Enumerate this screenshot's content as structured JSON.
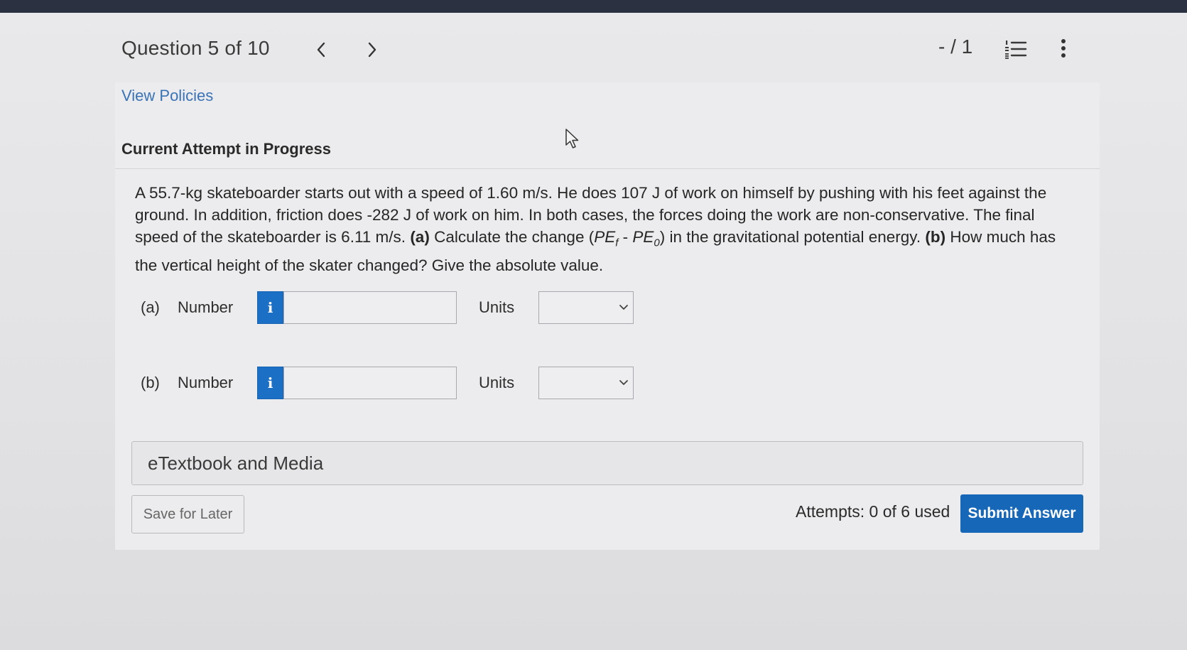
{
  "header": {
    "question_label": "Question 5 of 10",
    "score": "- / 1"
  },
  "policies_link": "View Policies",
  "attempt_heading": "Current Attempt in Progress",
  "question": {
    "intro": "A 55.7-kg skateboarder starts out with a speed of 1.60 m/s. He does 107 J of work on himself by pushing with his feet against the ground. In addition, friction does -282 J of work on him. In both cases, the forces doing the work are non-conservative. The final speed of the skateboarder is 6.11 m/s. ",
    "part_a_marker": "(a)",
    "part_a_text": " Calculate the change (",
    "pe_symbol_1": "PE",
    "sub_f": "f",
    "minus": " - ",
    "pe_symbol_2": "PE",
    "sub_0": "0",
    "part_a_tail": ") in the gravitational potential energy. ",
    "part_b_marker": "(b)",
    "part_b_text": " How much has the vertical height of the skater changed? Give the absolute value."
  },
  "answers": [
    {
      "part": "(a)",
      "number_label": "Number",
      "info_glyph": "i",
      "value": "",
      "units_label": "Units",
      "units_selected": ""
    },
    {
      "part": "(b)",
      "number_label": "Number",
      "info_glyph": "i",
      "value": "",
      "units_label": "Units",
      "units_selected": ""
    }
  ],
  "etextbook_label": "eTextbook and Media",
  "save_label": "Save for Later",
  "attempts_text": "Attempts: 0 of 6 used",
  "submit_label": "Submit Answer",
  "colors": {
    "accent": "#1667b8",
    "info": "#1b6fc4",
    "link": "#3a73b5",
    "topbar": "#2b3140"
  },
  "icons": [
    "chevron-left-icon",
    "chevron-right-icon",
    "numbered-list-icon",
    "more-vertical-icon",
    "info-icon",
    "chevron-down-icon",
    "mouse-pointer-icon"
  ]
}
